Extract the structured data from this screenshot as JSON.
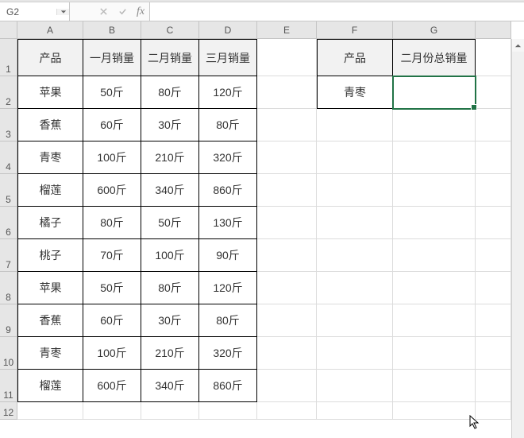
{
  "name_box": {
    "value": "G2"
  },
  "fx": {
    "label": "fx",
    "formula": ""
  },
  "columns": [
    "",
    "A",
    "B",
    "C",
    "D",
    "E",
    "F",
    "G",
    ""
  ],
  "row_headers": [
    "1",
    "2",
    "3",
    "4",
    "5",
    "6",
    "7",
    "8",
    "9",
    "10",
    "11",
    "12"
  ],
  "left_table": {
    "headers": [
      "产品",
      "一月销量",
      "二月销量",
      "三月销量"
    ],
    "rows": [
      [
        "苹果",
        "50斤",
        "80斤",
        "120斤"
      ],
      [
        "香蕉",
        "60斤",
        "30斤",
        "80斤"
      ],
      [
        "青枣",
        "100斤",
        "210斤",
        "320斤"
      ],
      [
        "榴莲",
        "600斤",
        "340斤",
        "860斤"
      ],
      [
        "橘子",
        "80斤",
        "50斤",
        "130斤"
      ],
      [
        "桃子",
        "70斤",
        "100斤",
        "90斤"
      ],
      [
        "苹果",
        "50斤",
        "80斤",
        "120斤"
      ],
      [
        "香蕉",
        "60斤",
        "30斤",
        "80斤"
      ],
      [
        "青枣",
        "100斤",
        "210斤",
        "320斤"
      ],
      [
        "榴莲",
        "600斤",
        "340斤",
        "860斤"
      ]
    ]
  },
  "right_table": {
    "headers": [
      "产品",
      "二月份总销量"
    ],
    "rows": [
      [
        "青枣",
        ""
      ]
    ]
  },
  "selected_cell": "G2"
}
